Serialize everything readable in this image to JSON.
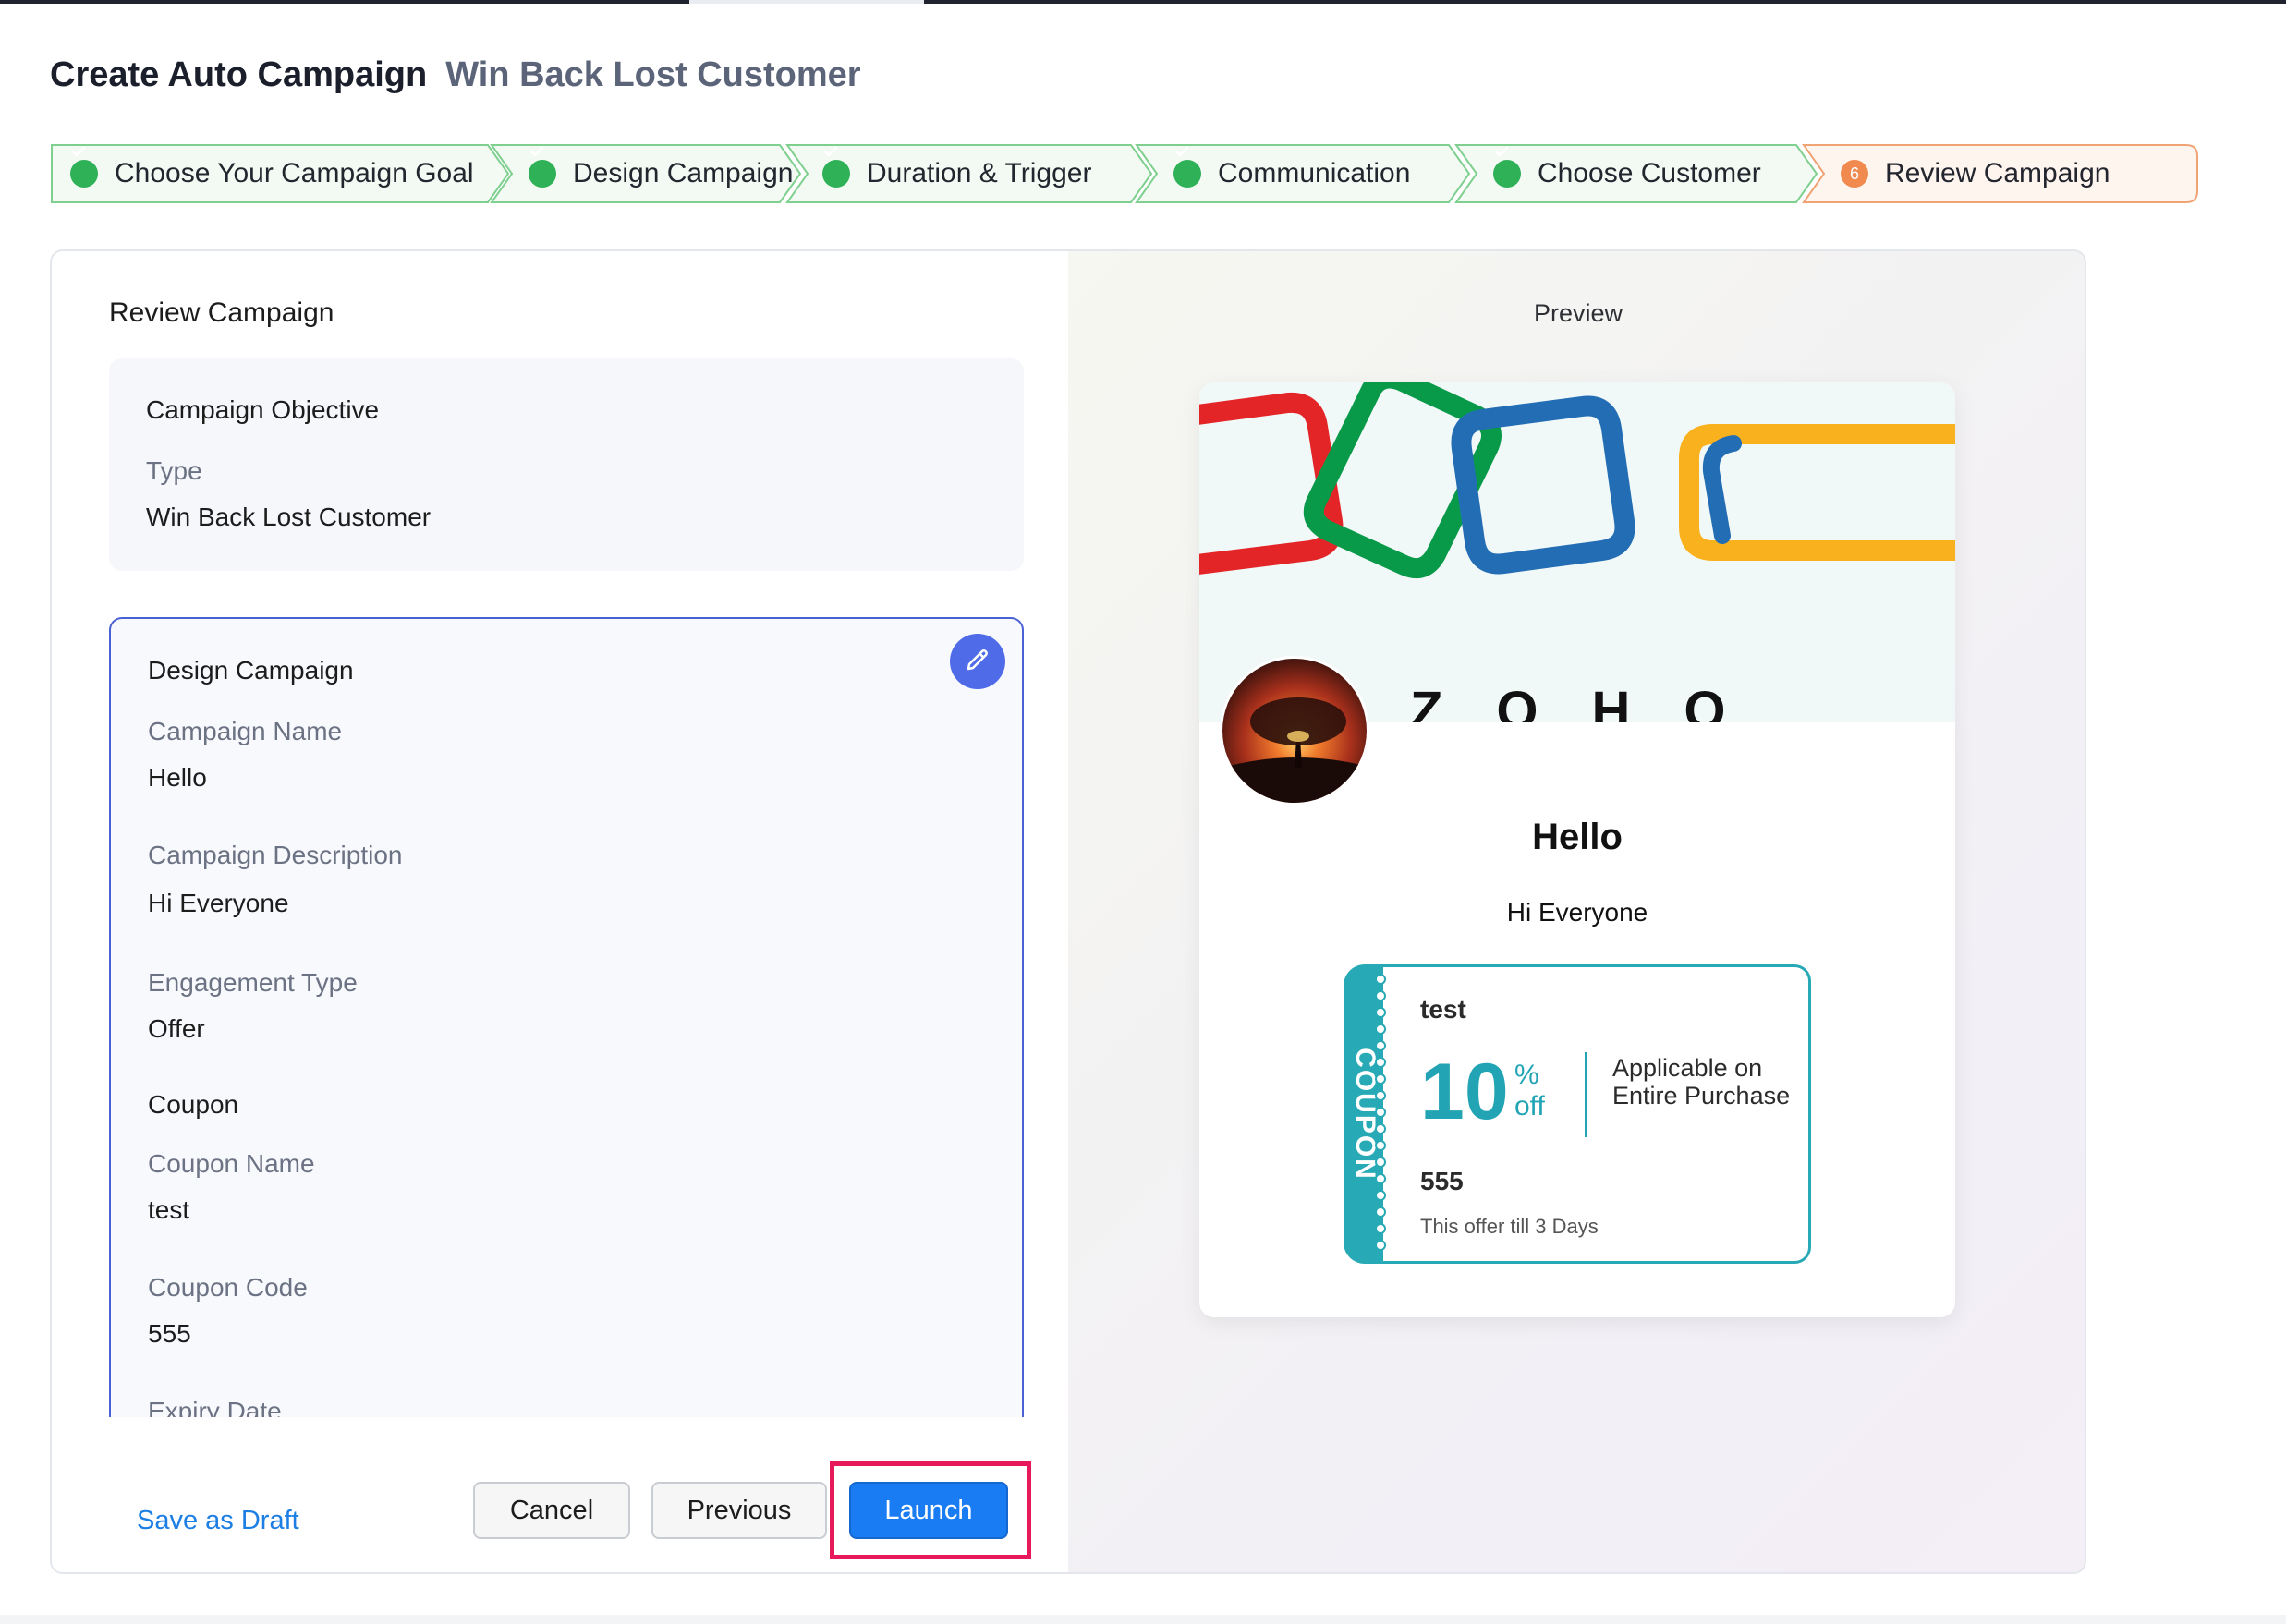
{
  "header": {
    "title": "Create Auto Campaign",
    "campaign_type": "Win Back Lost Customer"
  },
  "stepper": {
    "steps": [
      {
        "label": "Choose Your Campaign Goal",
        "status": "done"
      },
      {
        "label": "Design Campaign",
        "status": "done"
      },
      {
        "label": "Duration & Trigger",
        "status": "done"
      },
      {
        "label": "Communication",
        "status": "done"
      },
      {
        "label": "Choose Customer",
        "status": "done"
      },
      {
        "label": "Review Campaign",
        "status": "current",
        "number": "6"
      }
    ]
  },
  "review": {
    "heading": "Review Campaign",
    "objective": {
      "title": "Campaign Objective",
      "type_label": "Type",
      "type_value": "Win Back Lost Customer"
    },
    "design": {
      "title": "Design Campaign",
      "name_label": "Campaign Name",
      "name_value": "Hello",
      "description_label": "Campaign Description",
      "description_value": "Hi Everyone",
      "engagement_label": "Engagement Type",
      "engagement_value": "Offer",
      "coupon_heading": "Coupon",
      "coupon_name_label": "Coupon Name",
      "coupon_name_value": "test",
      "coupon_code_label": "Coupon Code",
      "coupon_code_value": "555",
      "expiry_label": "Expiry Date"
    }
  },
  "footer": {
    "save_draft": "Save as Draft",
    "cancel": "Cancel",
    "previous": "Previous",
    "launch": "Launch"
  },
  "preview": {
    "label": "Preview",
    "banner_text": "ZOHO",
    "title": "Hello",
    "description": "Hi Everyone",
    "coupon": {
      "strip_text": "COUPON",
      "name": "test",
      "discount": "10",
      "percent_sign": "%",
      "off_text": "off",
      "applicable": "Applicable on Entire Purchase",
      "code": "555",
      "expiry": "This offer till 3 Days"
    }
  },
  "colors": {
    "accent": "#1a7cf2",
    "success": "#2fb157",
    "current_step": "#f08a4f",
    "coupon": "#27aab5",
    "highlight": "#e8195a"
  }
}
